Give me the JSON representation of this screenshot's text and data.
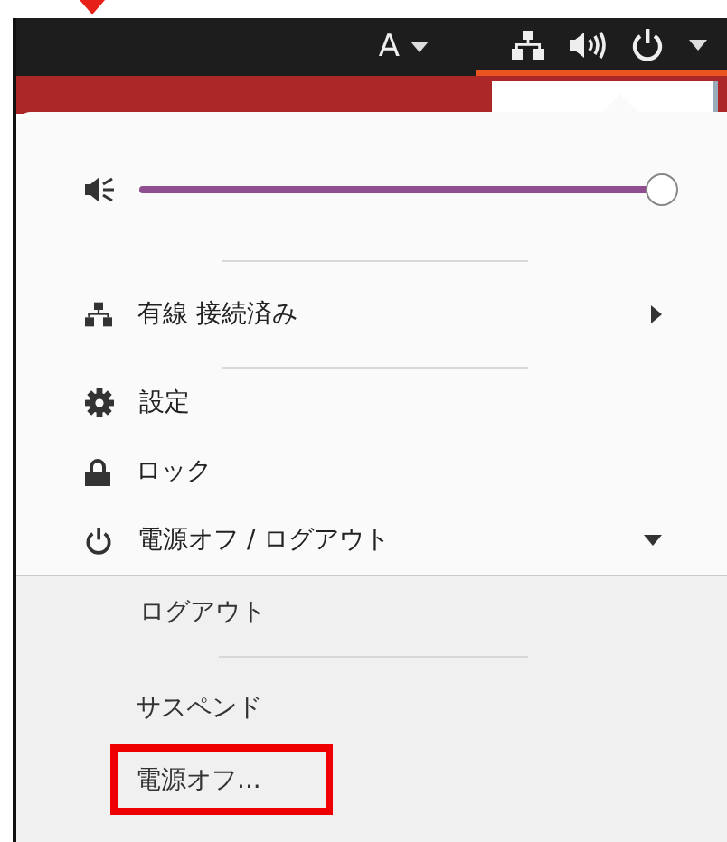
{
  "top_bar": {
    "input_method": "A",
    "menu_open": true
  },
  "volume": {
    "level": 0.97
  },
  "items": [
    {
      "kind": "network",
      "label": "有線 接続済み"
    },
    {
      "kind": "settings",
      "label": "設定"
    },
    {
      "kind": "lock",
      "label": "ロック"
    },
    {
      "kind": "power",
      "label": "電源オフ / ログアウト",
      "expanded": true
    }
  ],
  "submenu": [
    {
      "label": "ログアウト",
      "highlighted": false
    },
    {
      "kind": "separator"
    },
    {
      "label": "サスペンド",
      "highlighted": false
    },
    {
      "label": "電源オフ...",
      "highlighted": true
    }
  ]
}
